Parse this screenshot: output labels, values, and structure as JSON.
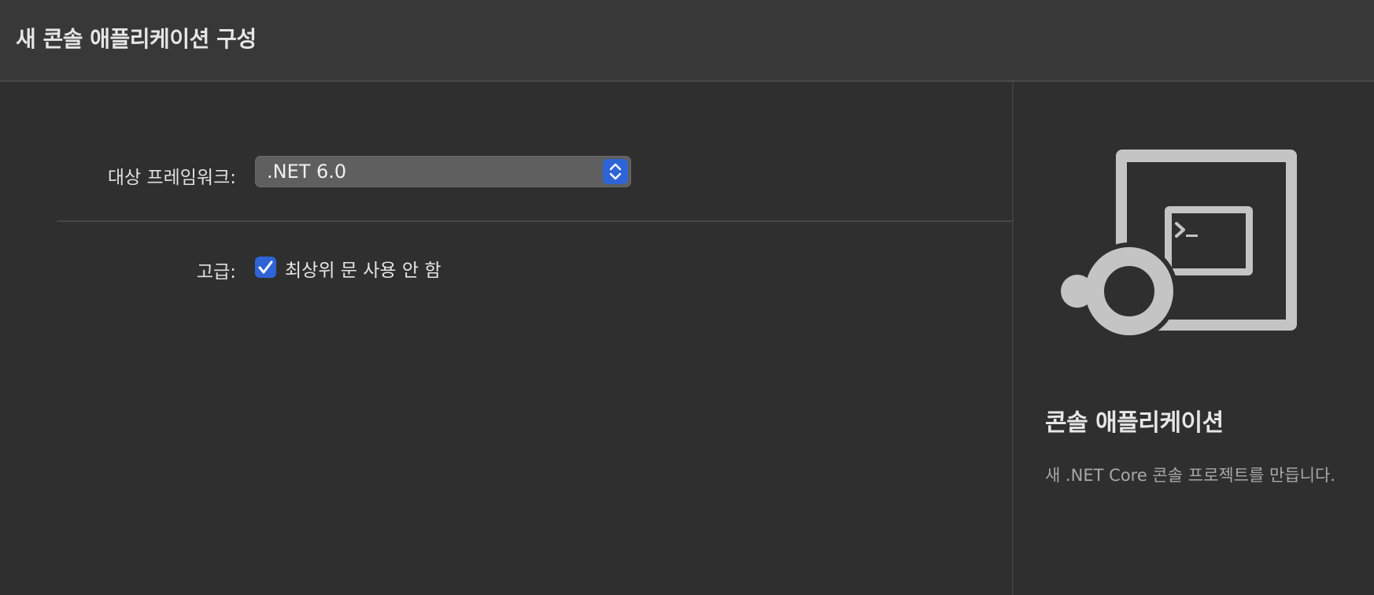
{
  "header": {
    "title": "새 콘솔 애플리케이션 구성"
  },
  "form": {
    "framework_label": "대상 프레임워크:",
    "framework_value": ".NET 6.0",
    "advanced_label": "고급:",
    "top_level_checkbox_label": "최상위 문 사용 안 함",
    "top_level_checked": true
  },
  "side": {
    "title": "콘솔 애플리케이션",
    "description": "새 .NET Core 콘솔 프로젝트를 만듭니다.",
    "icon": "console-app-illustration"
  },
  "colors": {
    "accent": "#2f64d6",
    "background": "#2f2f2f",
    "header": "#383838"
  }
}
